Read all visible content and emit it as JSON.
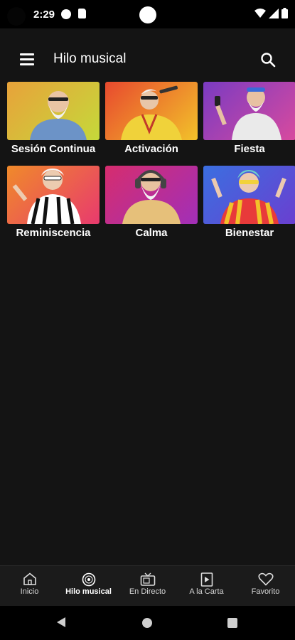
{
  "status_bar": {
    "time": "2:29"
  },
  "app_bar": {
    "title": "Hilo musical"
  },
  "tiles": [
    {
      "label": "Sesión Continua",
      "bg": "#e8a23a",
      "bg2": "#c5d93a"
    },
    {
      "label": "Activación",
      "bg": "#e8492e",
      "bg2": "#f2c22a"
    },
    {
      "label": "Fiesta",
      "bg": "#7a3bc2",
      "bg2": "#d84a9e"
    },
    {
      "label": "Reminiscencia",
      "bg": "#f08a2a",
      "bg2": "#e83a6e"
    },
    {
      "label": "Calma",
      "bg": "#d62d6e",
      "bg2": "#a12fb8"
    },
    {
      "label": "Bienestar",
      "bg": "#3b6fe0",
      "bg2": "#6a3fd0"
    }
  ],
  "bottom_nav": [
    {
      "label": "Inicio",
      "icon": "home-icon"
    },
    {
      "label": "Hilo musical",
      "icon": "music-disc-icon",
      "active": true
    },
    {
      "label": "En Directo",
      "icon": "tv-icon"
    },
    {
      "label": "A la Carta",
      "icon": "play-file-icon"
    },
    {
      "label": "Favorito",
      "icon": "heart-icon"
    }
  ]
}
